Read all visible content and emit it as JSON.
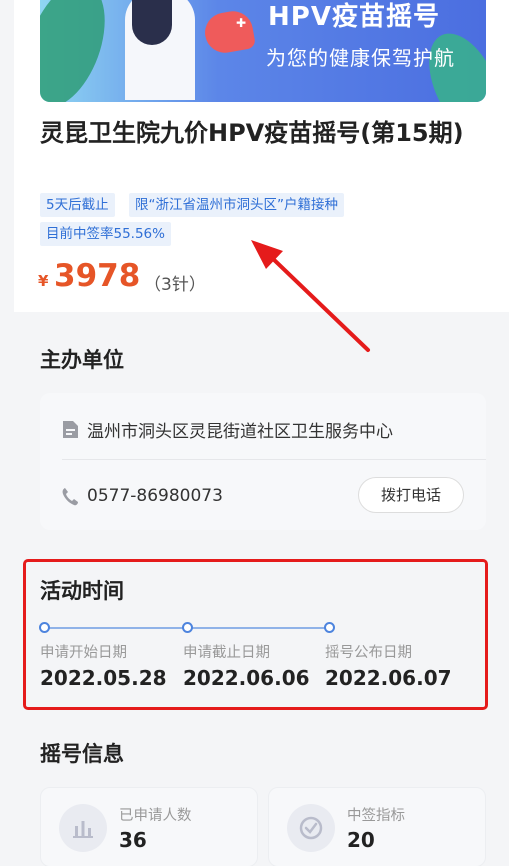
{
  "banner": {
    "title": "HPV疫苗摇号",
    "subtitle": "为您的健康保驾护航"
  },
  "event": {
    "title": "灵昆卫生院九价HPV疫苗摇号(第15期)",
    "tags": [
      "5天后截止",
      "限“浙江省温州市洞头区”户籍接种",
      "目前中签率55.56%"
    ],
    "price_symbol": "¥",
    "price": "3978",
    "price_unit": "（3针）"
  },
  "organizer": {
    "section_title": "主办单位",
    "name": "温州市洞头区灵昆街道社区卫生服务中心",
    "phone": "0577-86980073",
    "call_label": "拨打电话"
  },
  "activity_time": {
    "section_title": "活动时间",
    "steps": [
      {
        "label": "申请开始日期",
        "date": "2022.05.28"
      },
      {
        "label": "申请截止日期",
        "date": "2022.06.06"
      },
      {
        "label": "摇号公布日期",
        "date": "2022.06.07"
      }
    ]
  },
  "lottery_info": {
    "section_title": "摇号信息",
    "stats": [
      {
        "label": "已申请人数",
        "value": "36",
        "icon": "bar-chart-icon"
      },
      {
        "label": "中签指标",
        "value": "20",
        "icon": "check-circle-icon"
      }
    ]
  },
  "colors": {
    "price": "#e65527",
    "tag_bg": "#eaf1fb",
    "tag_text": "#2f6fd6",
    "highlight_box": "#e51b1b",
    "annotation_arrow": "#e51b1b"
  }
}
